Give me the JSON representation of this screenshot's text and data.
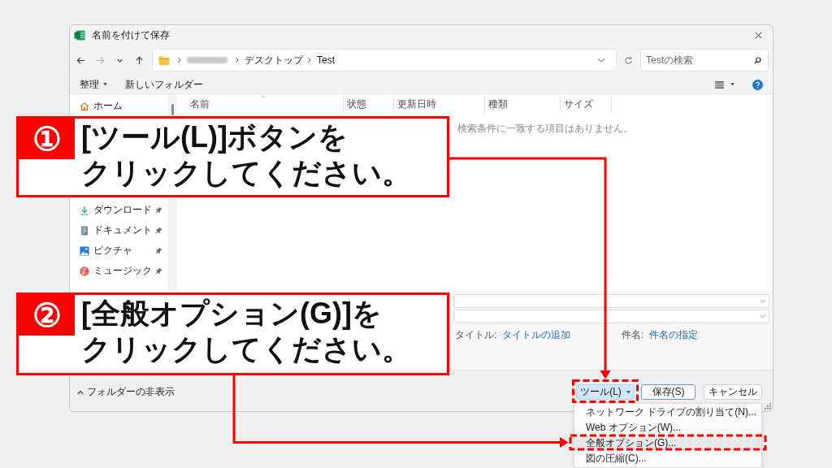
{
  "window": {
    "title": "名前を付けて保存"
  },
  "navigation": [
    {
      "kind": "back",
      "disabled": false
    },
    {
      "kind": "forward",
      "disabled": true
    },
    {
      "kind": "recent",
      "disabled": false
    },
    {
      "kind": "up",
      "disabled": false
    }
  ],
  "address_bar": {
    "path": [
      {
        "kind": "redacted"
      },
      {
        "kind": "folder",
        "label": "デスクトップ"
      },
      {
        "kind": "folder",
        "label": "Test"
      }
    ]
  },
  "search": {
    "placeholder": "Testの検索"
  },
  "command_bar": {
    "organize": "整理",
    "new_folder": "新しいフォルダー"
  },
  "sidebar": {
    "home": {
      "label": "ホーム"
    },
    "quick_access": [
      {
        "kind": "download",
        "label": "ダウンロード",
        "pinned": true
      },
      {
        "kind": "documents",
        "label": "ドキュメント",
        "pinned": true
      },
      {
        "kind": "pictures",
        "label": "ピクチャ",
        "pinned": true
      },
      {
        "kind": "music",
        "label": "ミュージック",
        "pinned": true
      }
    ]
  },
  "file_list": {
    "columns": [
      "名前",
      "状態",
      "更新日時",
      "種類",
      "サイズ"
    ],
    "empty_message": "検索条件に一致する項目はありません。"
  },
  "details": {
    "metadata": [
      {
        "label": "タイトル:",
        "value": "タイトルの追加"
      },
      {
        "label": "件名:",
        "value": "件名の指定"
      }
    ]
  },
  "footer": {
    "hide_folders": "フォルダーの非表示",
    "tools_button": {
      "label": "ツール(L)",
      "expanded": true
    },
    "save_button": {
      "label": "保存(S)",
      "default": true
    },
    "cancel_button": {
      "label": "キャンセル"
    }
  },
  "tools_menu": {
    "items": [
      {
        "label": "ネットワーク ドライブの割り当て(N)...",
        "selected": false
      },
      {
        "label": "Web オプション(W)...",
        "selected": false
      },
      {
        "label": "全般オプション(G)...",
        "selected": true
      },
      {
        "label": "図の圧縮(C)...",
        "selected": false
      }
    ]
  },
  "callouts": [
    {
      "number": "①",
      "lines": [
        "[ツール(L)]ボタンを",
        "クリックしてください。"
      ]
    },
    {
      "number": "②",
      "lines": [
        "[全般オプション(G)]を",
        "クリックしてください。"
      ]
    }
  ]
}
